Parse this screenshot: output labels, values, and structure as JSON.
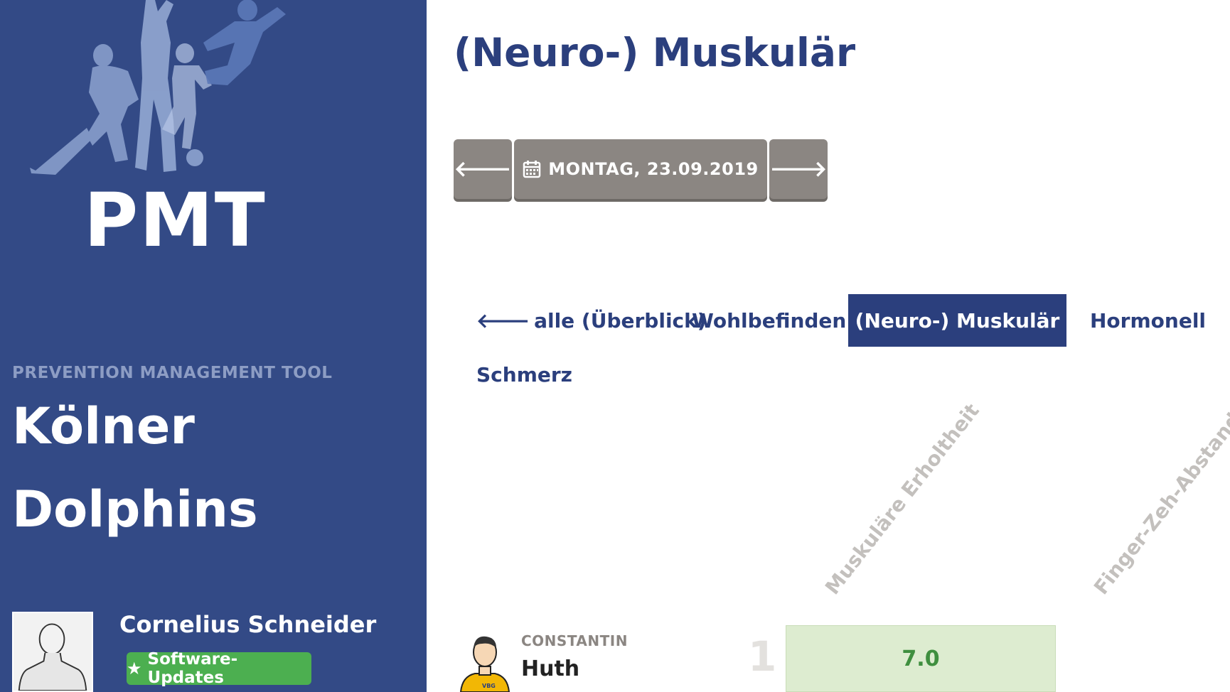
{
  "sidebar": {
    "logo_text": "PMT",
    "subtitle": "PREVENTION MANAGEMENT TOOL",
    "team_line1": "Kölner",
    "team_line2": "Dolphins",
    "user_name": "Cornelius Schneider",
    "updates_label": "Software-Updates",
    "updates_color": "#4caf50",
    "background_color": "#334a86"
  },
  "main": {
    "title": "(Neuro-) Muskulär",
    "date_nav": {
      "prev_icon": "arrow-left-icon",
      "date_icon": "calendar-icon",
      "date_label": "MONTAG, 23.09.2019",
      "next_icon": "arrow-right-icon"
    },
    "tabs": [
      {
        "label": "alle (Überblick)",
        "icon": "arrow-left-icon",
        "active": false
      },
      {
        "label": "Wohlbefinden",
        "active": false
      },
      {
        "label": "(Neuro-) Muskulär",
        "active": true
      },
      {
        "label": "Hormonell",
        "active": false
      },
      {
        "label": "Schmerz",
        "active": false
      }
    ],
    "columns": [
      "Muskuläre Erholtheit",
      "Finger-Zeh-Abstand"
    ],
    "rows": [
      {
        "rank": "1",
        "first_name": "CONSTANTIN",
        "last_name": "Huth",
        "values": [
          "7.0"
        ]
      }
    ],
    "accent_color": "#2b3f7d",
    "good_value_color": "#ddecd0"
  }
}
